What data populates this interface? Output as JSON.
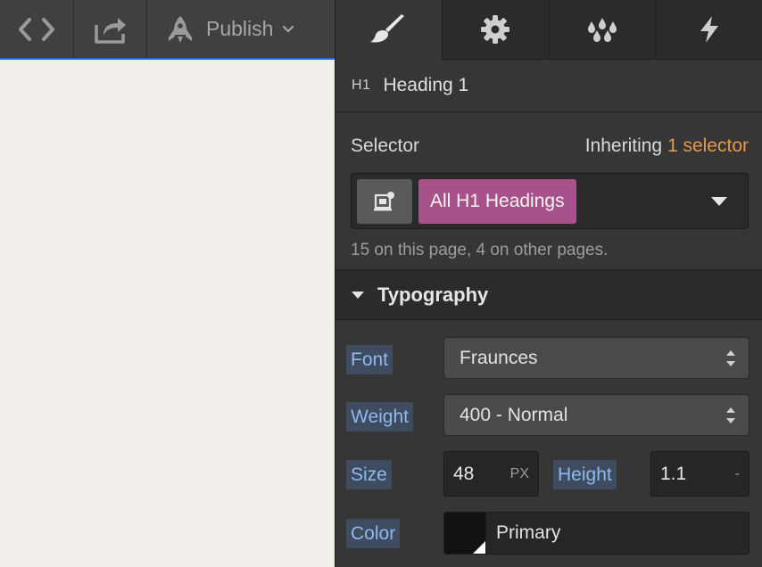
{
  "toolbar": {
    "publish_label": "Publish",
    "icons": [
      "code-icon",
      "export-icon",
      "rocket-icon",
      "chevron-down-icon"
    ]
  },
  "panel": {
    "tabs": [
      {
        "name": "style",
        "icon": "paintbrush-icon",
        "active": true
      },
      {
        "name": "settings",
        "icon": "gear-icon",
        "active": false
      },
      {
        "name": "style-manager",
        "icon": "drops-icon",
        "active": false
      },
      {
        "name": "interactions",
        "icon": "lightning-icon",
        "active": false
      }
    ],
    "element": {
      "tag": "H1",
      "name": "Heading 1"
    },
    "selector": {
      "label": "Selector",
      "inheriting_prefix": "Inheriting ",
      "inheriting_link": "1 selector",
      "chip": "All H1 Headings",
      "note": "15 on this page, 4 on other pages."
    },
    "typography": {
      "title": "Typography",
      "font_label": "Font",
      "font_value": "Fraunces",
      "weight_label": "Weight",
      "weight_value": "400 - Normal",
      "size_label": "Size",
      "size_value": "48",
      "size_unit": "PX",
      "height_label": "Height",
      "height_value": "1.1",
      "height_unit": "-",
      "color_label": "Color",
      "color_value": "Primary"
    }
  },
  "colors": {
    "canvas": "#f2efeb",
    "accent_blue": "#1f6fd1",
    "chip_pink": "#a8518a",
    "inherit_orange": "#e09a4c",
    "label_blue": "#8eb9ee"
  }
}
